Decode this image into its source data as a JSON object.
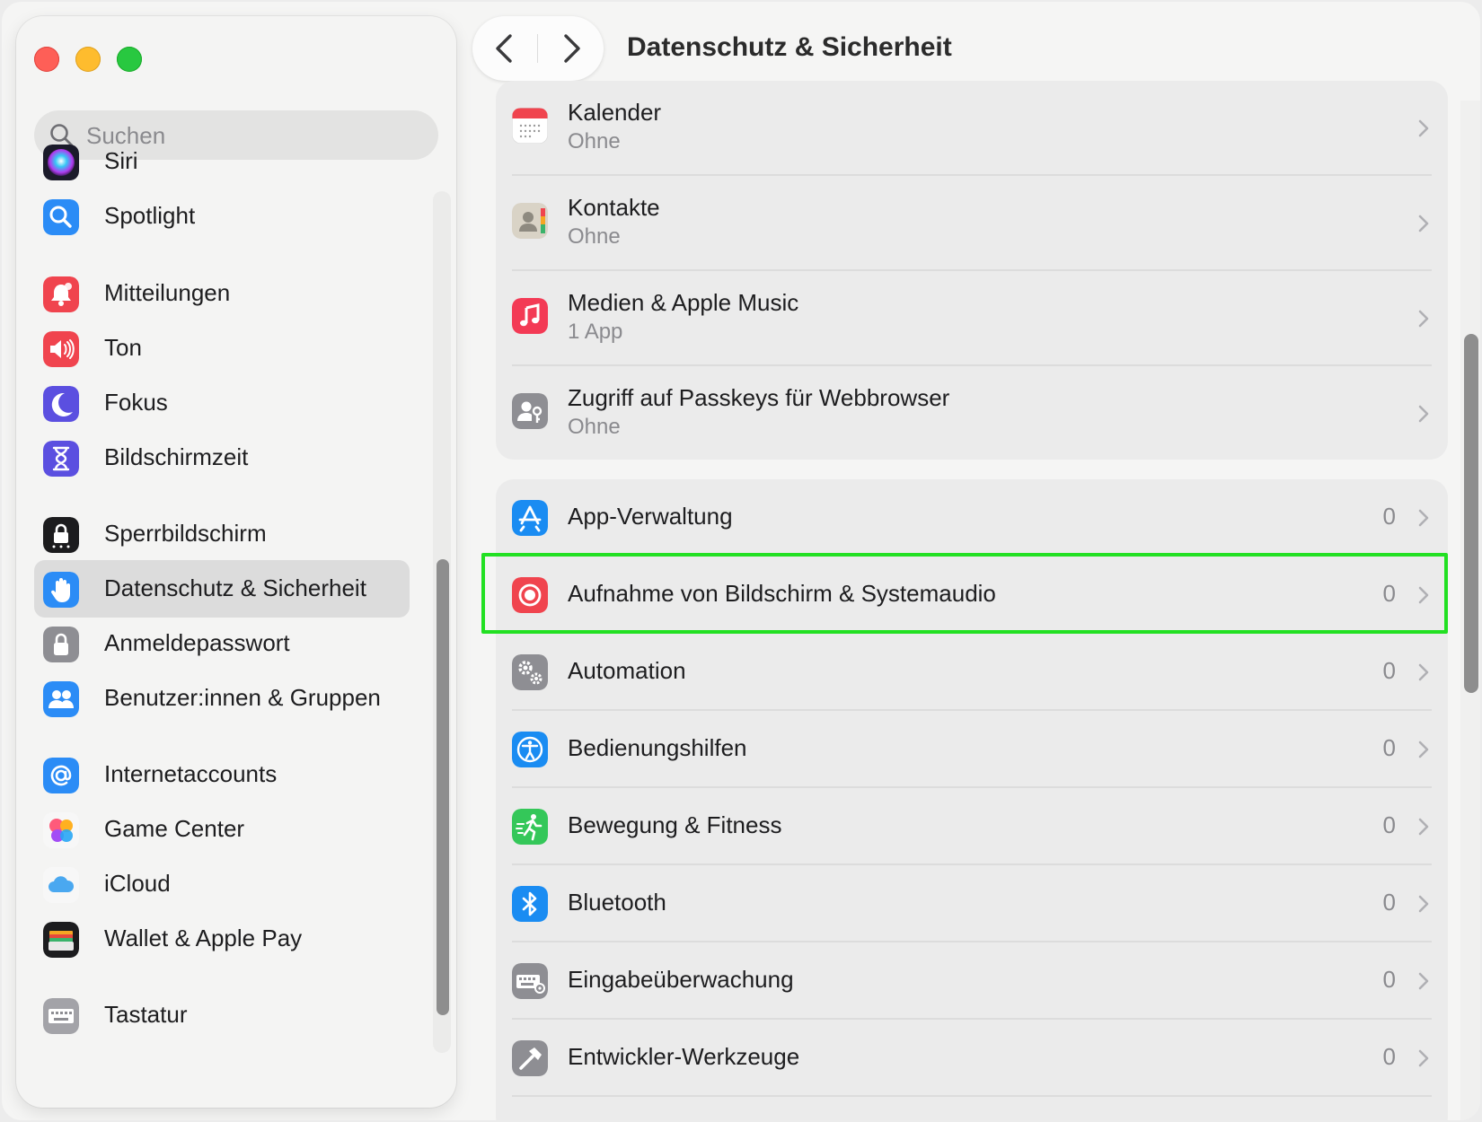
{
  "window": {
    "title": "Datenschutz & Sicherheit"
  },
  "search": {
    "placeholder": "Suchen"
  },
  "sidebar": {
    "items": [
      {
        "label": "Siri",
        "icon": "siri-icon"
      },
      {
        "label": "Spotlight",
        "icon": "spotlight-icon"
      },
      {
        "label": "Mitteilungen",
        "icon": "bell-icon"
      },
      {
        "label": "Ton",
        "icon": "speaker-icon"
      },
      {
        "label": "Fokus",
        "icon": "moon-icon"
      },
      {
        "label": "Bildschirmzeit",
        "icon": "hourglass-icon"
      },
      {
        "label": "Sperrbildschirm",
        "icon": "lock-screen-icon"
      },
      {
        "label": "Datenschutz & Sicherheit",
        "icon": "hand-icon",
        "selected": true
      },
      {
        "label": "Anmeldepasswort",
        "icon": "padlock-icon"
      },
      {
        "label": "Benutzer:innen & Gruppen",
        "icon": "users-icon"
      },
      {
        "label": "Internetaccounts",
        "icon": "at-icon"
      },
      {
        "label": "Game Center",
        "icon": "game-center-icon"
      },
      {
        "label": "iCloud",
        "icon": "cloud-icon"
      },
      {
        "label": "Wallet & Apple Pay",
        "icon": "wallet-icon"
      },
      {
        "label": "Tastatur",
        "icon": "keyboard-icon"
      }
    ]
  },
  "main": {
    "group1": [
      {
        "title": "Kalender",
        "subtitle": "Ohne",
        "icon": "calendar-icon"
      },
      {
        "title": "Kontakte",
        "subtitle": "Ohne",
        "icon": "contacts-icon"
      },
      {
        "title": "Medien & Apple Music",
        "subtitle": "1 App",
        "icon": "music-icon"
      },
      {
        "title": "Zugriff auf Passkeys für Webbrowser",
        "subtitle": "Ohne",
        "icon": "passkey-icon"
      }
    ],
    "group2": [
      {
        "title": "App-Verwaltung",
        "count": "0",
        "icon": "app-store-icon"
      },
      {
        "title": "Aufnahme von Bildschirm & Systemaudio",
        "count": "0",
        "icon": "record-icon",
        "highlighted": true
      },
      {
        "title": "Automation",
        "count": "0",
        "icon": "gears-icon"
      },
      {
        "title": "Bedienungshilfen",
        "count": "0",
        "icon": "accessibility-icon"
      },
      {
        "title": "Bewegung & Fitness",
        "count": "0",
        "icon": "running-icon"
      },
      {
        "title": "Bluetooth",
        "count": "0",
        "icon": "bluetooth-icon"
      },
      {
        "title": "Eingabeüberwachung",
        "count": "0",
        "icon": "keyboard-monitor-icon"
      },
      {
        "title": "Entwickler-Werkzeuge",
        "count": "0",
        "icon": "hammer-icon"
      }
    ]
  },
  "colors": {
    "highlight": "#22e022",
    "selected_bg": "#dcdcdc"
  }
}
